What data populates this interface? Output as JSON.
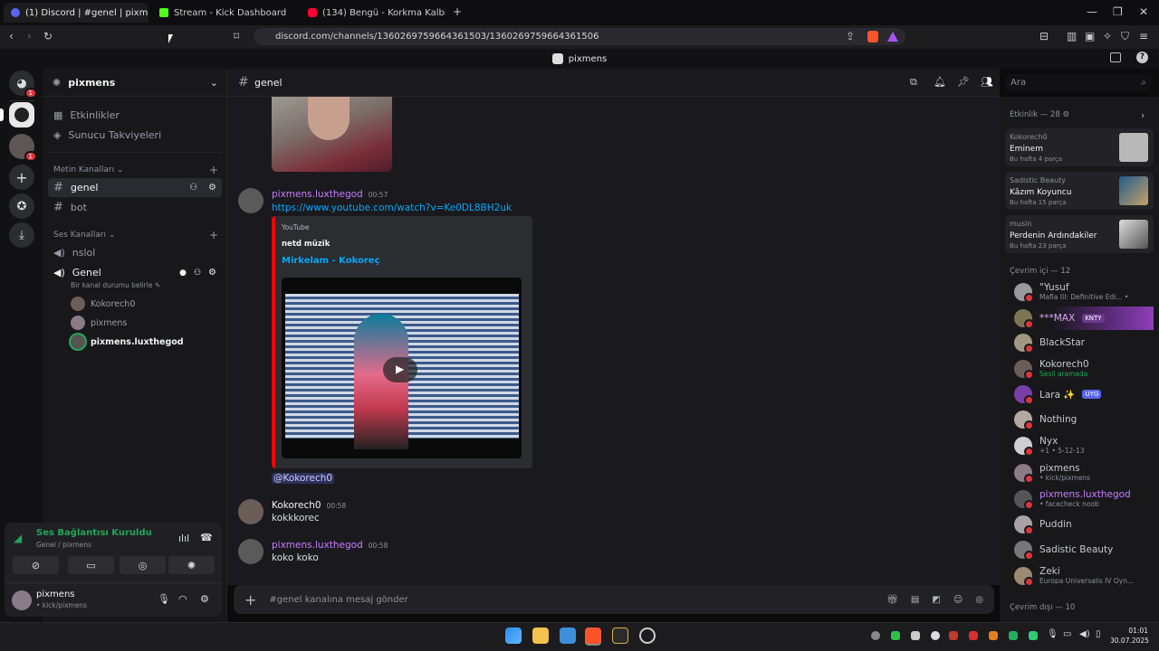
{
  "browser": {
    "tabs": [
      {
        "title": "(1) Discord | #genel | pixmens",
        "active": true
      },
      {
        "title": "Stream - Kick Dashboard",
        "active": false
      },
      {
        "title": "(134) Bengü - Korkma Kalbim - YouT",
        "active": false
      }
    ],
    "url": "discord.com/channels/1360269759664361503/1360269759664361506"
  },
  "app_title": "pixmens",
  "server": {
    "name": "pixmens",
    "rail_badges": [
      "1",
      "1"
    ]
  },
  "sidebar": {
    "top_items": [
      "Etkinlikler",
      "Sunucu Takviyeleri"
    ],
    "text_category": "Metin Kanalları",
    "text_channels": [
      "genel",
      "bot"
    ],
    "voice_category": "Ses Kanalları",
    "voice_channels": [
      "nslol",
      "Genel"
    ],
    "voice_status": "Bir kanal durumu belirle",
    "voice_users": [
      "Kokorech0",
      "pixmens",
      "pixmens.luxthegod"
    ]
  },
  "voice_panel": {
    "status": "Ses Bağlantısı Kuruldu",
    "location": "Genel / pixmens",
    "user": "pixmens",
    "user_status": "• kick/pixmens"
  },
  "channel": {
    "name": "genel",
    "search_placeholder": "Ara"
  },
  "messages": [
    {
      "author": "pixmens.luxthegod",
      "time": "00:57",
      "link": "https://www.youtube.com/watch?v=Ke0DL8BH2uk",
      "embed": {
        "provider": "YouTube",
        "author": "netd müzik",
        "title": "Mirkelam - Kokoreç"
      },
      "mention": "@Kokorech0"
    },
    {
      "author": "Kokorech0",
      "time": "00:58",
      "text": "kokkkorec"
    },
    {
      "author": "pixmens.luxthegod",
      "time": "00:58",
      "text": "koko koko"
    }
  ],
  "composer_placeholder": "#genel kanalına mesaj gönder",
  "members": {
    "activity_header": "Etkinlik — 28",
    "activities": [
      {
        "user": "Kokorech0",
        "title": "Eminem",
        "sub": "Bu hafta 4 parça"
      },
      {
        "user": "Sadistic Beauty",
        "title": "Kâzım Koyuncu",
        "sub": "Bu hafta 15 parça"
      },
      {
        "user": "musin",
        "title": "Perdenin Ardındakiler",
        "sub": "Bu hafta 23 parça"
      }
    ],
    "online_header": "Çevrim içi — 12",
    "online": [
      {
        "name": "\"Yusuf",
        "sub": "Mafia III: Definitive Edi... •"
      },
      {
        "name": "***MAX",
        "sub": "",
        "tag": "KNTY"
      },
      {
        "name": "BlackStar",
        "sub": ""
      },
      {
        "name": "Kokorech0",
        "sub": "Sesli aramada"
      },
      {
        "name": "Lara ✨",
        "sub": "",
        "tag": "UYG"
      },
      {
        "name": "Nothing",
        "sub": ""
      },
      {
        "name": "Nyx",
        "sub": "+1 • 5-12-13"
      },
      {
        "name": "pixmens",
        "sub": "• kick/pixmens"
      },
      {
        "name": "pixmens.luxthegod",
        "sub": "• facecheck noob"
      },
      {
        "name": "Puddin",
        "sub": ""
      },
      {
        "name": "Sadistic Beauty",
        "sub": ""
      },
      {
        "name": "Zeki",
        "sub": "Europa Universalis IV Oyn..."
      }
    ],
    "offline_header": "Çevrim dışı — 10"
  },
  "clock": {
    "time": "01:01",
    "date": "30.07.2025"
  },
  "colors": {
    "accent": "#5865f2",
    "username_purple": "#c77dff",
    "link": "#00a8fc",
    "embed_bar": "#ff0000",
    "online_green": "#23a55a",
    "dnd_red": "#da373c"
  }
}
